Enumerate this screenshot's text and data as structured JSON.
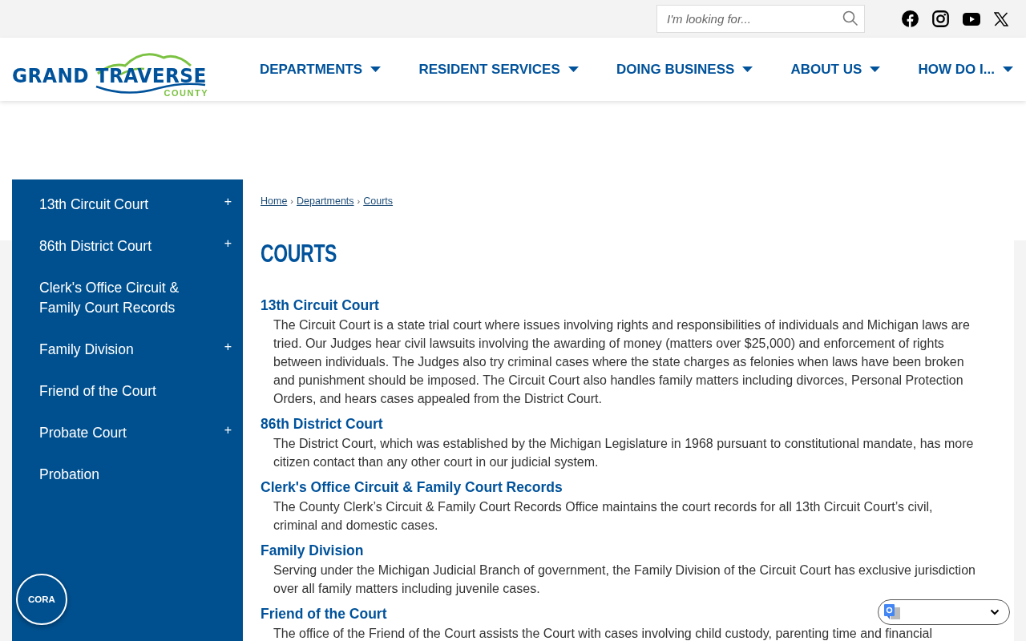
{
  "search": {
    "placeholder": "I'm looking for..."
  },
  "logo": {
    "name": "GRAND TRAVERSE",
    "subtitle": "COUNTY"
  },
  "nav": [
    {
      "label": "DEPARTMENTS"
    },
    {
      "label": "RESIDENT SERVICES"
    },
    {
      "label": "DOING BUSINESS"
    },
    {
      "label": "ABOUT US"
    },
    {
      "label": "HOW DO I..."
    }
  ],
  "sidebar": {
    "items": [
      {
        "label": "13th Circuit Court",
        "expandable": true
      },
      {
        "label": "86th District Court",
        "expandable": true
      },
      {
        "label": "Clerk's Office Circuit & Family Court Records",
        "expandable": false
      },
      {
        "label": "Family Division",
        "expandable": true
      },
      {
        "label": "Friend of the Court",
        "expandable": false
      },
      {
        "label": "Probate Court",
        "expandable": true
      },
      {
        "label": "Probation",
        "expandable": false
      }
    ],
    "expand_symbol": "+"
  },
  "breadcrumbs": {
    "items": [
      "Home",
      "Departments",
      "Courts"
    ],
    "separator": "›"
  },
  "page_title": "COURTS",
  "sections": [
    {
      "heading": "13th Circuit Court",
      "text": "The Circuit Court is a state trial court where issues involving rights and responsibilities of individuals and Michigan laws are tried. Our Judges hear civil lawsuits involving the awarding of money (matters over $25,000) and enforcement of rights between individuals. The Judges also try criminal cases where the state charges as felonies when laws have been broken and punishment should be imposed. The Circuit Court also handles family matters including divorces, Personal Protection Orders, and hears cases appealed from the District Court."
    },
    {
      "heading": "86th District Court",
      "text": "The District Court, which was established by the Michigan Legislature in 1968 pursuant to constitutional mandate, has more citizen contact than any other court in our judicial system."
    },
    {
      "heading": "Clerk's Office Circuit & Family Court Records",
      "text": "The County Clerk’s Circuit & Family Court Records Office maintains the court records for all 13th Circuit Court’s civil, criminal and domestic cases."
    },
    {
      "heading": "Family Division",
      "text": "Serving under the Michigan Judicial Branch of government, the Family Division of the Circuit Court has exclusive jurisdiction over all family matters including juvenile cases."
    },
    {
      "heading": "Friend of the Court",
      "text": "The office of the Friend of the Court assists the Court with cases involving child custody, parenting time and financial"
    }
  ],
  "cora_button": "CORA"
}
